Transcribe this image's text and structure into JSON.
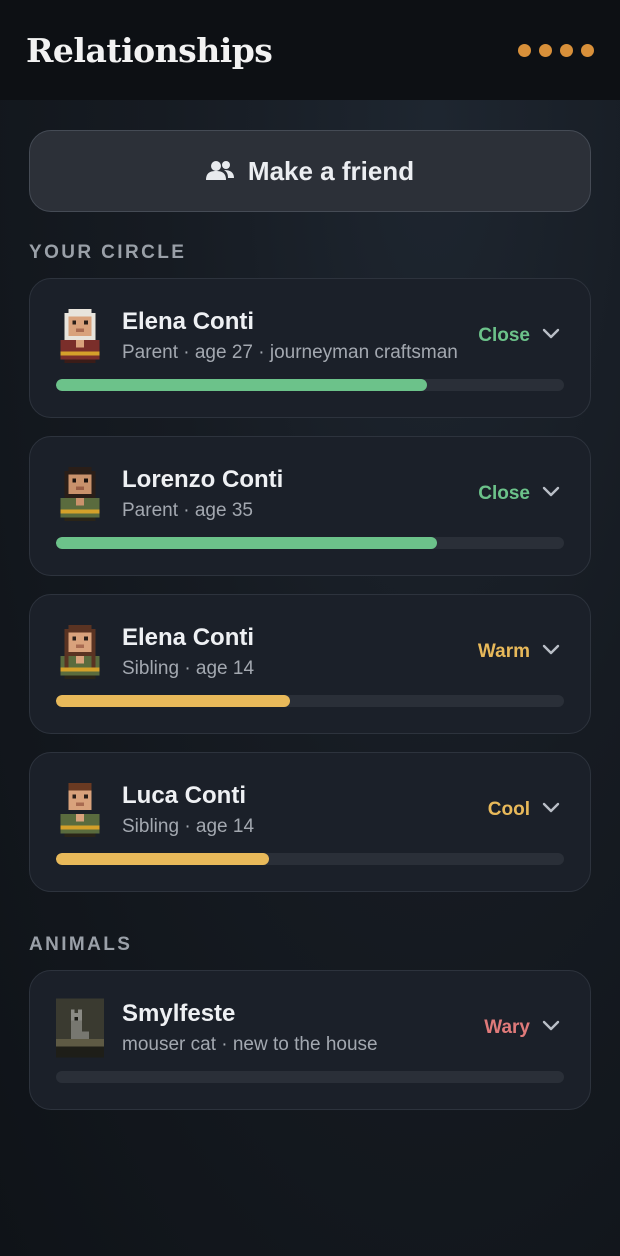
{
  "header": {
    "title": "Relationships",
    "menu_icon": "more-dots-icon"
  },
  "make_friend": {
    "label": "Make a friend",
    "icon": "people-icon"
  },
  "sections": {
    "circle_label": "YOUR CIRCLE",
    "animals_label": "ANIMALS"
  },
  "colors": {
    "close": "#6cc28a",
    "warm": "#e8b95a",
    "cool": "#e8b95a",
    "wary": "#e07a7a",
    "accent": "#d8903a"
  },
  "circle": [
    {
      "name": "Elena Conti",
      "sub": "Parent · age 27 · journeyman craftsman",
      "status": "Close",
      "level": 0.73
    },
    {
      "name": "Lorenzo Conti",
      "sub": "Parent · age 35",
      "status": "Close",
      "level": 0.75
    },
    {
      "name": "Elena Conti",
      "sub": "Sibling · age 14",
      "status": "Warm",
      "level": 0.46
    },
    {
      "name": "Luca Conti",
      "sub": "Sibling · age 14",
      "status": "Cool",
      "level": 0.42
    }
  ],
  "animals": [
    {
      "name": "Smylfeste",
      "sub": "mouser cat · new to the house",
      "status": "Wary",
      "level": 0.0
    }
  ]
}
